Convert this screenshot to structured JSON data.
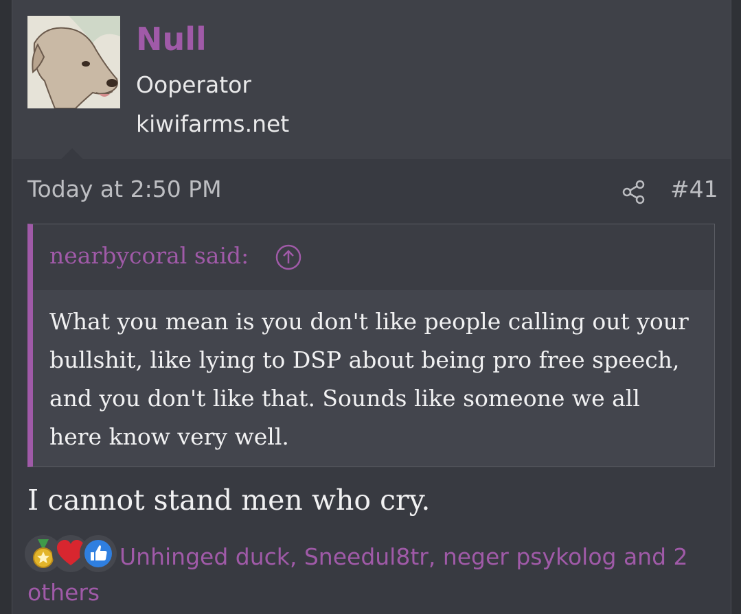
{
  "user": {
    "name": "Null",
    "title": "Ooperator",
    "banner": "kiwifarms.net",
    "avatar_icon": "dog-avatar"
  },
  "post": {
    "date": "Today at 2:50 PM",
    "share_icon": "share-icon",
    "number": "#41",
    "message": "I cannot stand men who cry."
  },
  "quote": {
    "author_label": "nearbycoral said:",
    "up_icon": "arrow-up-circle-icon",
    "text": "What you mean is you don't like people calling out your bullshit, like lying to DSP about being pro free speech, and you don't like that. Sounds like someone we all here know very well."
  },
  "reactions": {
    "icons": [
      "medal-icon",
      "heart-icon",
      "like-icon"
    ],
    "users_text": "Unhinged duck, Sneedul8tr, neger psykolog and 2 others"
  },
  "colors": {
    "accent": "#a05aa8",
    "background": "#383a41",
    "header": "#3f4148",
    "text": "#f1f1f2"
  }
}
